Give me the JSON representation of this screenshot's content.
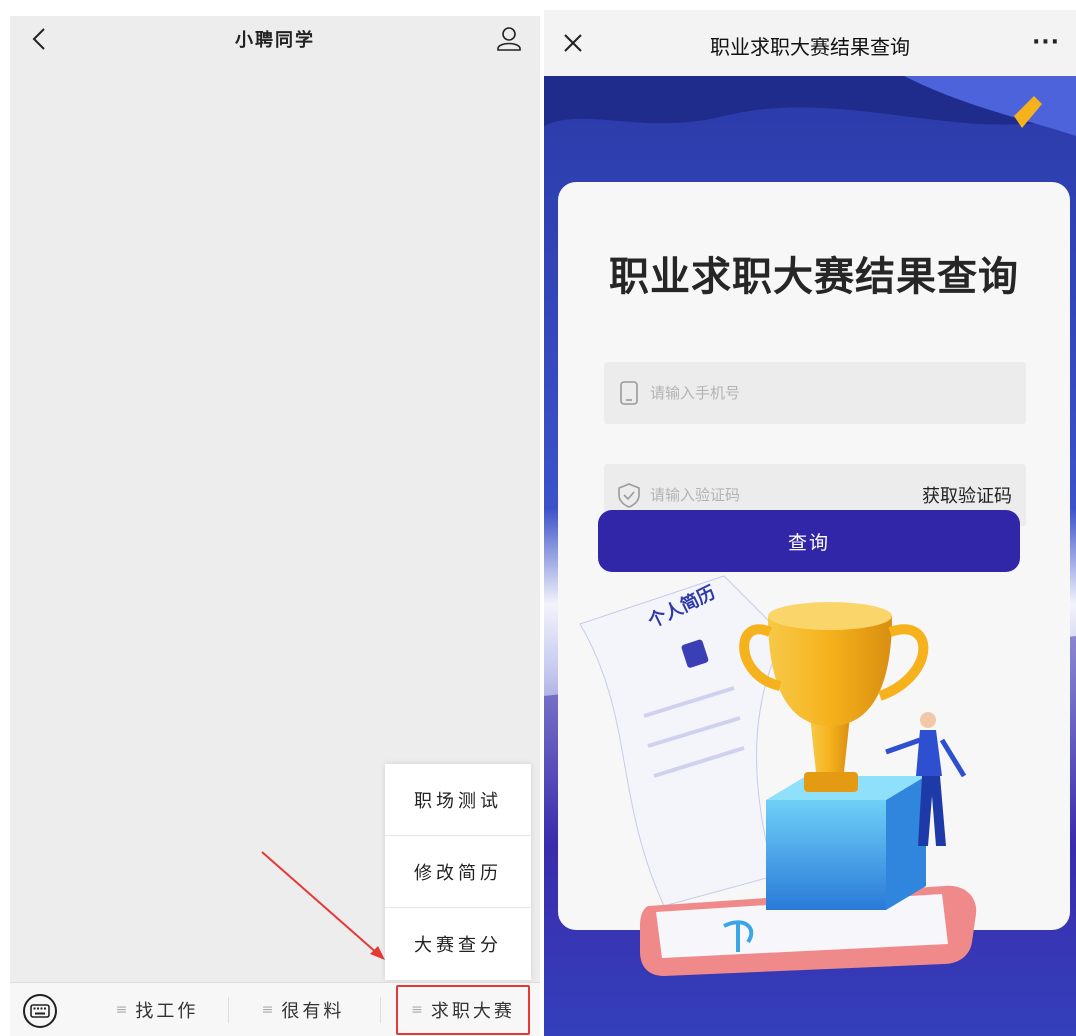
{
  "left": {
    "title": "小聘同学",
    "popup_menu": [
      {
        "label": "职场测试"
      },
      {
        "label": "修改简历"
      },
      {
        "label": "大赛查分"
      }
    ],
    "bottom_tabs": [
      {
        "label": "找工作"
      },
      {
        "label": "很有料"
      },
      {
        "label": "求职大赛"
      }
    ],
    "colors": {
      "highlight": "#e53935"
    }
  },
  "right": {
    "nav_title": "职业求职大赛结果查询",
    "more_label": "···",
    "card_title": "职业求职大赛结果查询",
    "phone_placeholder": "请输入手机号",
    "code_placeholder": "请输入验证码",
    "get_code_label": "获取验证码",
    "submit_label": "查询",
    "resume_label": "个人简历",
    "colors": {
      "primary": "#3126a8",
      "background": "#2e3fb0",
      "trophy": "#f5b21c"
    }
  }
}
